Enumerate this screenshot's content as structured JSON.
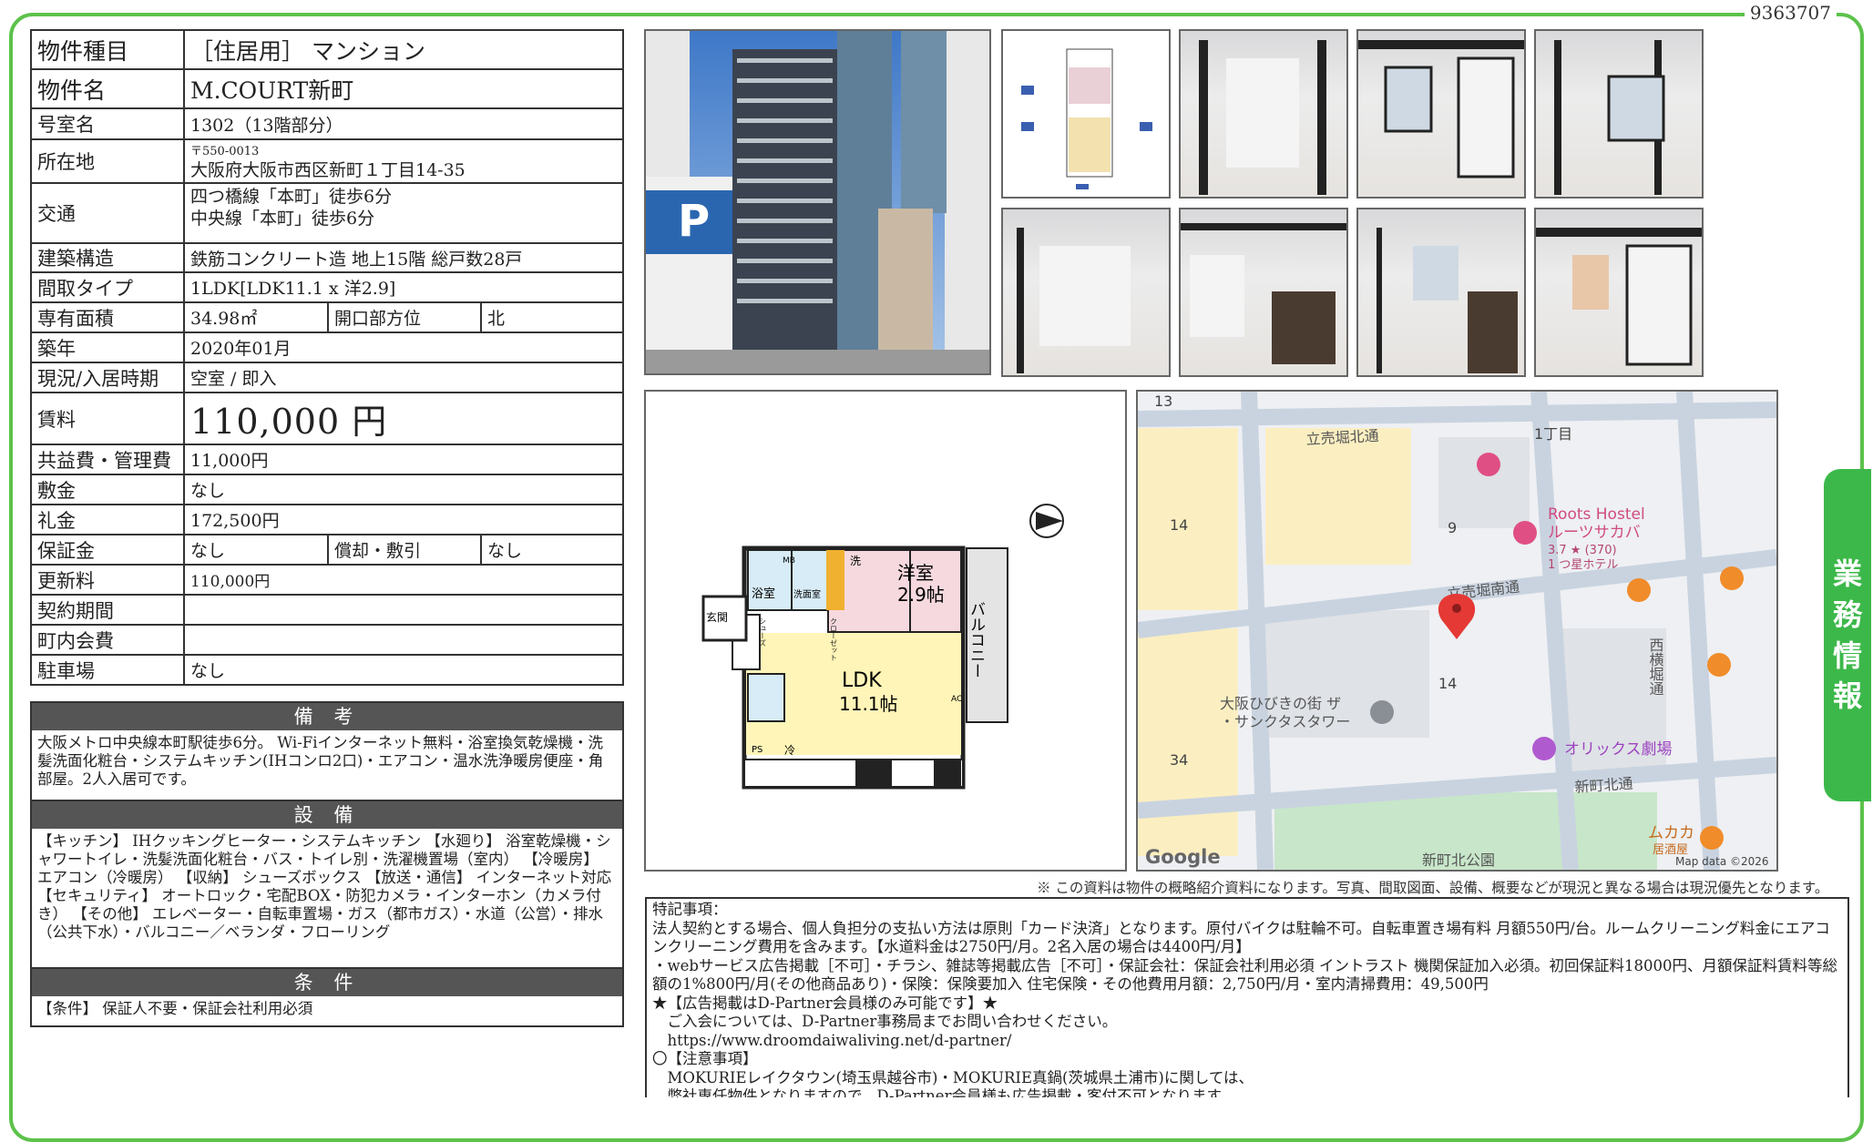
{
  "doc_id": "9363707",
  "side_tab": [
    "業",
    "務",
    "情",
    "報"
  ],
  "rows": {
    "type_label": "物件種目",
    "type_value": "［住居用］ マンション",
    "name_label": "物件名",
    "name_value": "M.COURT新町",
    "room_label": "号室名",
    "room_value": "1302（13階部分）",
    "addr_label": "所在地",
    "addr_zip": "〒550-0013",
    "addr_value": "大阪府大阪市西区新町１丁目14-35",
    "access_label": "交通",
    "access_1": "四つ橋線「本町」徒歩6分",
    "access_2": "中央線「本町」徒歩6分",
    "struct_label": "建築構造",
    "struct_value": "鉄筋コンクリート造 地上15階 総戸数28戸",
    "layout_label": "間取タイプ",
    "layout_value": "1LDK[LDK11.1 x 洋2.9]",
    "area_label": "専有面積",
    "area_value": "34.98㎡",
    "dir_label": "開口部方位",
    "dir_value": "北",
    "built_label": "築年",
    "built_value": "2020年01月",
    "status_label": "現況/入居時期",
    "status_value": "空室 / 即入",
    "rent_label": "賃料",
    "rent_value": "110,000 円",
    "fee_label": "共益費・管理費",
    "fee_value": "11,000円",
    "deposit_label": "敷金",
    "deposit_value": "なし",
    "key_label": "礼金",
    "key_value": "172,500円",
    "guar_label": "保証金",
    "guar_value": "なし",
    "amort_label": "償却・敷引",
    "amort_value": "なし",
    "renew_label": "更新料",
    "renew_value": "110,000円",
    "term_label": "契約期間",
    "term_value": "",
    "assoc_label": "町内会費",
    "assoc_value": "",
    "parking_label": "駐車場",
    "parking_value": "なし"
  },
  "remarks": {
    "title": "備 考",
    "body": "大阪メトロ中央線本町駅徒歩6分。 Wi-Fiインターネット無料・浴室換気乾燥機・洗髪洗面化粧台・システムキッチン(IHコンロ2口)・エアコン・温水洗浄暖房便座・角部屋。2人入居可です。"
  },
  "equipment": {
    "title": "設 備",
    "body": "【キッチン】 IHクッキングヒーター・システムキッチン 【水廻り】 浴室乾燥機・シャワートイレ・洗髪洗面化粧台・バス・トイレ別・洗濯機置場（室内） 【冷暖房】 エアコン（冷暖房） 【収納】 シューズボックス 【放送・通信】 インターネット対応 【セキュリティ】 オートロック・宅配BOX・防犯カメラ・インターホン（カメラ付き） 【その他】 エレベーター・自転車置場・ガス（都市ガス）・水道（公営）・排水（公共下水）・バルコニー／ベランダ・フローリング"
  },
  "conditions": {
    "title": "条 件",
    "body": "【条件】 保証人不要・保証会社利用必須"
  },
  "floorplan": {
    "western_room": "洋室",
    "western_size": "2.9帖",
    "ldk": "LDK",
    "ldk_size": "11.1帖",
    "balcony": "バルコニー",
    "bath": "浴室",
    "washroom": "洗面室",
    "entrance": "玄関",
    "closet": "クローゼット",
    "shoes": "シューズ",
    "mb": "MB",
    "ps": "PS",
    "cold": "冷",
    "wash": "洗",
    "ac": "AC"
  },
  "map": {
    "street_1": "立売堀北通",
    "street_2": "立売堀南通",
    "street_3": "新町北通",
    "street_4": "西横堀通",
    "block_1": "13",
    "block_2": "1丁目",
    "block_3": "14",
    "block_4": "9",
    "block_5": "14",
    "block_6": "34",
    "poi_hostel": "Roots Hostel",
    "poi_hostel_jp": "ルーツサカバ",
    "poi_hostel_rating": "3.7 ★ (370)",
    "poi_hostel_type": "1 つ星ホテル",
    "poi_tower_1": "大阪ひびきの街 ザ",
    "poi_tower_2": "・サンクタスタワー",
    "poi_theater": "オリックス劇場",
    "poi_park": "新町北公園",
    "poi_izakaya": "ムカカ",
    "poi_izakaya_type": "居酒屋",
    "google": "Google",
    "mapdata": "Map data ©2026"
  },
  "disclaimer": "※ この資料は物件の概略紹介資料になります。写真、間取図面、設備、概要などが現況と異なる場合は現況優先となります。",
  "notes": [
    "特記事項：",
    "法人契約とする場合、個人負担分の支払い方法は原則「カード決済」となります。原付バイクは駐輪不可。自転車置き場有料 月額550円/台。ルームクリーニング料金にエアコンクリーニング費用を含みます。【水道料金は2750円/月。2名入居の場合は4400円/月】",
    "・webサービス広告掲載［不可］・チラシ、雑誌等掲載広告［不可］・保証会社：保証会社利用必須 イントラスト 機関保証加入必須。初回保証料18000円、月額保証料賃料等総額の1%800円/月(その他商品あり)・保険：保険要加入 住宅保険・その他費用月額：2,750円/月・室内清掃費用：49,500円",
    "★【広告掲載はD-Partner会員様のみ可能です】★",
    "　ご入会については、D-Partner事務局までお問い合わせください。",
    "　https://www.droomdaiwaliving.net/d-partner/",
    "〇【注意事項】",
    "　MOKURIEレイクタウン(埼玉県越谷市)・MOKURIE真鍋(茨城県土浦市)に関しては、",
    "　弊社専任物件となりますので、D-Partner会員様も広告掲載・客付不可となります。"
  ]
}
